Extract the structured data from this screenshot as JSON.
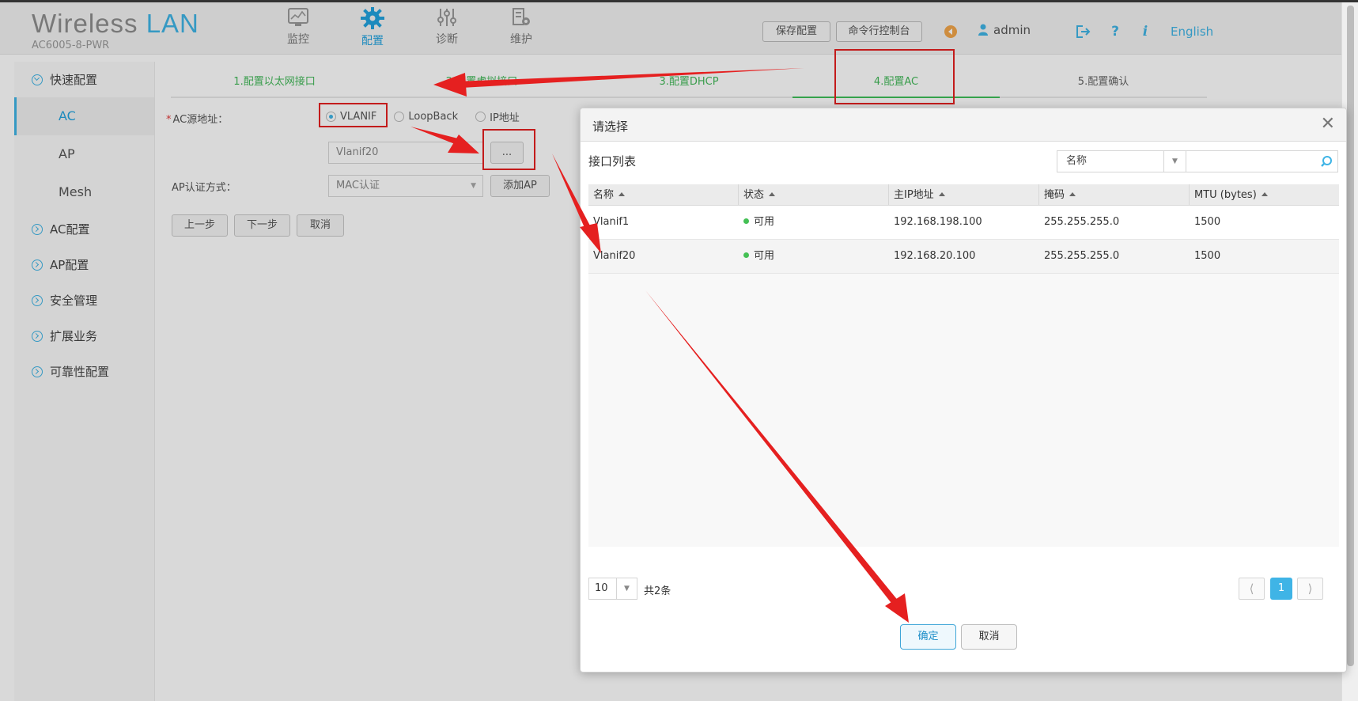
{
  "header": {
    "brand_word1": "Wireless",
    "brand_word2": "LAN",
    "model": "AC6005-8-PWR",
    "nav": [
      {
        "label": "监控",
        "icon": "monitor-icon"
      },
      {
        "label": "配置",
        "icon": "gear-icon",
        "active": true
      },
      {
        "label": "诊断",
        "icon": "sliders-icon"
      },
      {
        "label": "维护",
        "icon": "maintenance-icon"
      }
    ],
    "save_config": "保存配置",
    "cli_console": "命令行控制台",
    "user": "admin",
    "language": "English"
  },
  "sidebar": {
    "groups": [
      {
        "label": "快速配置",
        "expanded": true,
        "items": [
          "AC",
          "AP",
          "Mesh"
        ],
        "active_item": "AC"
      },
      {
        "label": "AC配置"
      },
      {
        "label": "AP配置"
      },
      {
        "label": "安全管理"
      },
      {
        "label": "扩展业务"
      },
      {
        "label": "可靠性配置"
      }
    ]
  },
  "wizard": {
    "steps": [
      "1.配置以太网接口",
      "2.配置虚拟接口",
      "3.配置DHCP",
      "4.配置AC",
      "5.配置确认"
    ],
    "active_step": 4,
    "ac_source_label": "AC源地址：",
    "source_options": [
      "VLANIF",
      "LoopBack",
      "IP地址"
    ],
    "source_selected": "VLANIF",
    "source_value": "Vlanif20",
    "browse_label": "...",
    "auth_label": "AP认证方式：",
    "auth_value": "MAC认证",
    "add_ap": "添加AP",
    "prev": "上一步",
    "next": "下一步",
    "cancel": "取消"
  },
  "dialog": {
    "title": "请选择",
    "list_title": "接口列表",
    "filter_field": "名称",
    "filter_value": "",
    "columns": [
      "名称",
      "状态",
      "主IP地址",
      "掩码",
      "MTU (bytes)"
    ],
    "rows": [
      {
        "name": "Vlanif1",
        "status": "可用",
        "ip": "192.168.198.100",
        "mask": "255.255.255.0",
        "mtu": "1500"
      },
      {
        "name": "Vlanif20",
        "status": "可用",
        "ip": "192.168.20.100",
        "mask": "255.255.255.0",
        "mtu": "1500"
      }
    ],
    "page_size": "10",
    "total": "共2条",
    "current_page": "1",
    "prev_icon": "chevron-left-icon",
    "next_icon": "chevron-right-icon",
    "ok": "确定",
    "cancel": "取消"
  },
  "colors": {
    "accent": "#3fb4e6",
    "wizard_green": "#44b95a",
    "annotation_red": "#e52020",
    "status_green": "#44c054"
  }
}
